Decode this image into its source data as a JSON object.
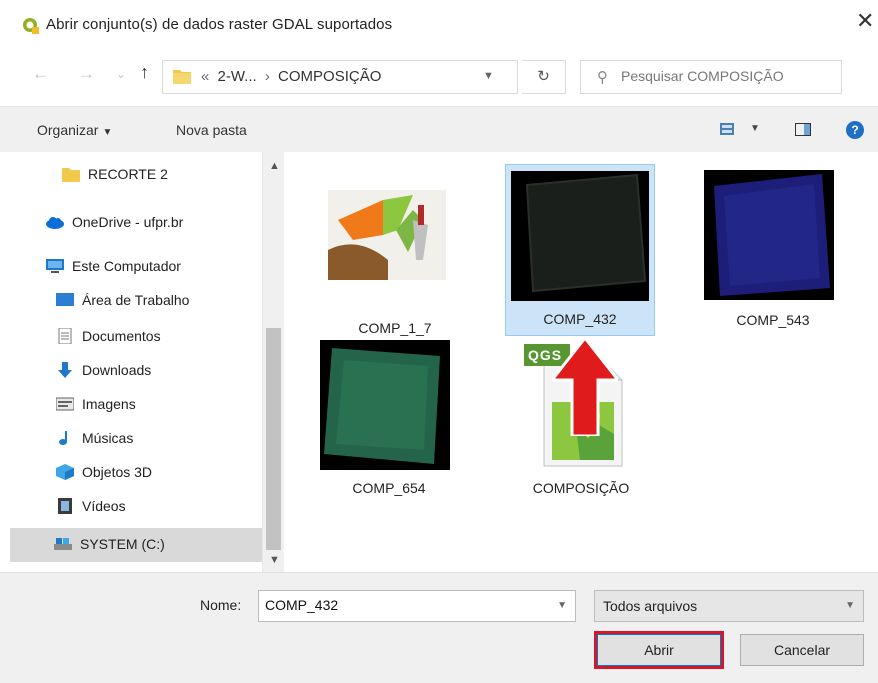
{
  "window": {
    "title": "Abrir conjunto(s) de dados raster GDAL suportados",
    "close_glyph": "✕"
  },
  "nav": {
    "back_glyph": "←",
    "forward_glyph": "→",
    "recent_glyph": "⌄",
    "up_glyph": "↑",
    "breadcrumb": [
      "«",
      "2-W...",
      "›",
      "COMPOSIÇÃO"
    ],
    "refresh_glyph": "↻",
    "search_placeholder": "Pesquisar COMPOSIÇÃO"
  },
  "toolbar": {
    "organize_label": "Organizar",
    "new_folder_label": "Nova pasta",
    "help_glyph": "?"
  },
  "sidebar": {
    "items": [
      {
        "label": "RECORTE 2",
        "icon": "folder-icon"
      },
      {
        "label": "OneDrive - ufpr.br",
        "icon": "cloud-icon"
      },
      {
        "label": "Este Computador",
        "icon": "computer-icon"
      },
      {
        "label": "Área de Trabalho",
        "icon": "desktop-icon"
      },
      {
        "label": "Documentos",
        "icon": "document-icon"
      },
      {
        "label": "Downloads",
        "icon": "download-icon"
      },
      {
        "label": "Imagens",
        "icon": "image-icon"
      },
      {
        "label": "Músicas",
        "icon": "music-icon"
      },
      {
        "label": "Objetos 3D",
        "icon": "cube-icon"
      },
      {
        "label": "Vídeos",
        "icon": "video-icon"
      },
      {
        "label": "SYSTEM (C:)",
        "icon": "drive-icon"
      }
    ],
    "selected": "SYSTEM (C:)"
  },
  "files": [
    {
      "name": "COMP_1_7",
      "type": "thumbnail-map"
    },
    {
      "name": "COMP_432",
      "type": "raster-dark",
      "selected": true
    },
    {
      "name": "COMP_543",
      "type": "raster-blue"
    },
    {
      "name": "COMP_654",
      "type": "raster-green"
    },
    {
      "name": "COMPOSIÇÃO",
      "type": "qgis-project"
    }
  ],
  "footer": {
    "name_label": "Nome:",
    "name_value": "COMP_432",
    "filter_value": "Todos arquivos",
    "open_label": "Abrir",
    "cancel_label": "Cancelar"
  },
  "colors": {
    "selection": "#cce4f7",
    "highlight_box": "#d3182b",
    "arrow": "#e01b1b",
    "qgis_green": "#589632"
  },
  "qgis_badge": "QGS"
}
